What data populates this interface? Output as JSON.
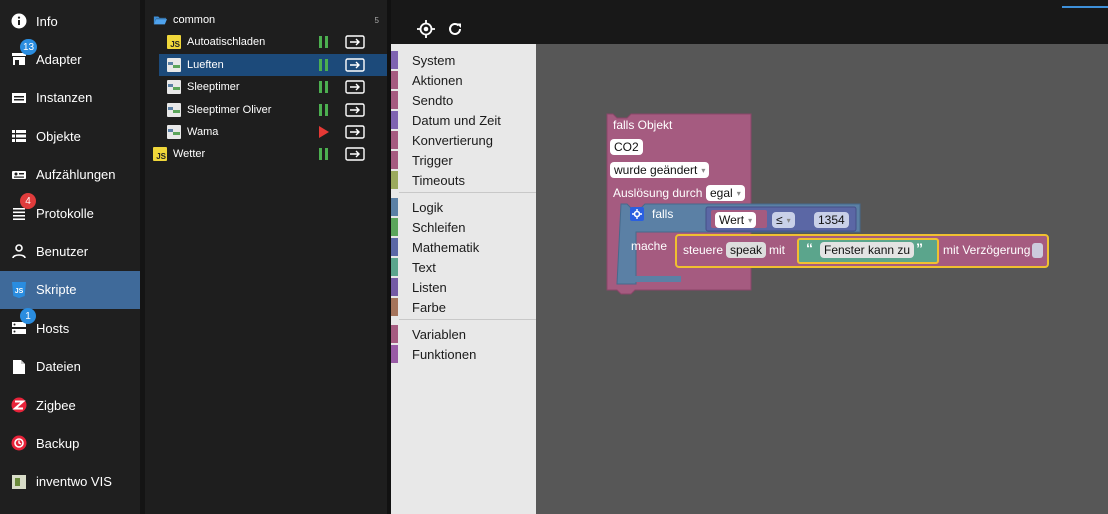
{
  "nav": {
    "items": [
      {
        "label": "Info",
        "icon": "info-icon"
      },
      {
        "label": "Adapter",
        "icon": "store-icon",
        "badge": "13",
        "badge_color": "#2a8de0"
      },
      {
        "label": "Instanzen",
        "icon": "instances-icon"
      },
      {
        "label": "Objekte",
        "icon": "list-icon"
      },
      {
        "label": "Aufzählungen",
        "icon": "enum-icon"
      },
      {
        "label": "Protokolle",
        "icon": "log-icon",
        "badge": "4",
        "badge_color": "#e03c3c"
      },
      {
        "label": "Benutzer",
        "icon": "user-icon"
      },
      {
        "label": "Skripte",
        "icon": "js-icon",
        "active": true
      },
      {
        "label": "Hosts",
        "icon": "hosts-icon",
        "badge": "1",
        "badge_color": "#2a8de0"
      },
      {
        "label": "Dateien",
        "icon": "file-icon"
      },
      {
        "label": "Zigbee",
        "icon": "zigbee-icon"
      },
      {
        "label": "Backup",
        "icon": "backup-icon"
      },
      {
        "label": "inventwo VIS",
        "icon": "vis-icon"
      }
    ]
  },
  "tree": {
    "folder": {
      "label": "common",
      "count": "5"
    },
    "scripts": [
      {
        "label": "Autoatischladen",
        "type": "js",
        "status": "running"
      },
      {
        "label": "Lueften",
        "type": "blockly",
        "status": "running",
        "selected": true
      },
      {
        "label": "Sleeptimer",
        "type": "blockly",
        "status": "running"
      },
      {
        "label": "Sleeptimer Oliver",
        "type": "blockly",
        "status": "running"
      },
      {
        "label": "Wama",
        "type": "blockly",
        "status": "stopped"
      }
    ],
    "root_scripts": [
      {
        "label": "Wetter",
        "type": "js",
        "status": "running"
      }
    ]
  },
  "toolbar": {
    "buttons": [
      "locate-icon",
      "refresh-icon"
    ]
  },
  "toolbox": {
    "groups": [
      [
        {
          "label": "System",
          "color": "#7f64b0"
        },
        {
          "label": "Aktionen",
          "color": "#a55b80"
        },
        {
          "label": "Sendto",
          "color": "#a55b80"
        },
        {
          "label": "Datum und Zeit",
          "color": "#7f64b0"
        },
        {
          "label": "Konvertierung",
          "color": "#a55b80"
        },
        {
          "label": "Trigger",
          "color": "#a55b80"
        },
        {
          "label": "Timeouts",
          "color": "#9aa95c"
        }
      ],
      [
        {
          "label": "Logik",
          "color": "#5b80a5"
        },
        {
          "label": "Schleifen",
          "color": "#5ba55b"
        },
        {
          "label": "Mathematik",
          "color": "#5b67a5"
        },
        {
          "label": "Text",
          "color": "#5ba58c"
        },
        {
          "label": "Listen",
          "color": "#745ba5"
        },
        {
          "label": "Farbe",
          "color": "#a5745b"
        }
      ],
      [
        {
          "label": "Variablen",
          "color": "#a55b80"
        },
        {
          "label": "Funktionen",
          "color": "#995ba5"
        }
      ]
    ]
  },
  "blocks": {
    "trigger": {
      "title": "falls Objekt",
      "object": "CO2",
      "event": "wurde geändert",
      "ack_label": "Auslösung durch",
      "ack_value": "egal",
      "color": "#a55b80"
    },
    "if_block": {
      "label": "falls",
      "do_label": "mache",
      "color": "#5b80a5"
    },
    "compare": {
      "left": "Wert",
      "op": "≤",
      "right": "1354"
    },
    "control": {
      "label": "steuere",
      "target": "speak",
      "with": "mit",
      "delay_label": "mit Verzögerung",
      "text_open": "“",
      "text_close": "”",
      "text": "Fenster kann zu"
    }
  }
}
